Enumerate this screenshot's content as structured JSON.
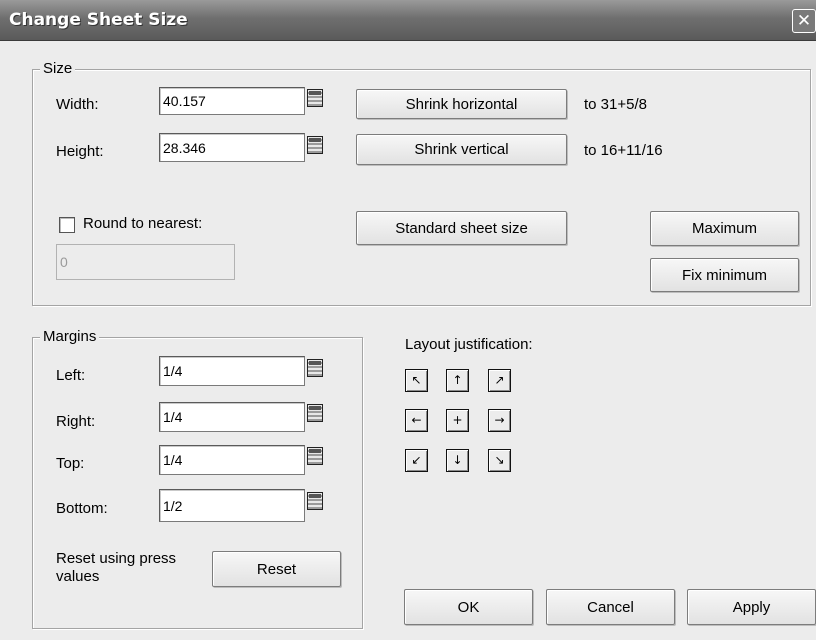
{
  "window": {
    "title": "Change Sheet Size",
    "close_glyph": "✕"
  },
  "size": {
    "legend": "Size",
    "width_label": "Width:",
    "width_value": "40.157",
    "height_label": "Height:",
    "height_value": "28.346",
    "shrink_horizontal_label": "Shrink horizontal",
    "shrink_horizontal_result": "to 31+5/8",
    "shrink_vertical_label": "Shrink vertical",
    "shrink_vertical_result": "to 16+11/16",
    "round_label": "Round to nearest:",
    "round_checked": false,
    "round_value": "0",
    "standard_sheet_label": "Standard sheet size",
    "maximum_label": "Maximum",
    "fix_minimum_label": "Fix minimum"
  },
  "margins": {
    "legend": "Margins",
    "left_label": "Left:",
    "left_value": "1/4",
    "right_label": "Right:",
    "right_value": "1/4",
    "top_label": "Top:",
    "top_value": "1/4",
    "bottom_label": "Bottom:",
    "bottom_value": "1/2",
    "reset_text": "Reset using press values",
    "reset_label": "Reset"
  },
  "layout": {
    "label": "Layout justification:",
    "buttons": [
      {
        "glyph": "↖"
      },
      {
        "glyph": "↑"
      },
      {
        "glyph": "↗"
      },
      {
        "glyph": "←"
      },
      {
        "glyph": "+"
      },
      {
        "glyph": "→"
      },
      {
        "glyph": "↙"
      },
      {
        "glyph": "↓"
      },
      {
        "glyph": "↘"
      }
    ]
  },
  "footer": {
    "ok_label": "OK",
    "cancel_label": "Cancel",
    "apply_label": "Apply"
  }
}
